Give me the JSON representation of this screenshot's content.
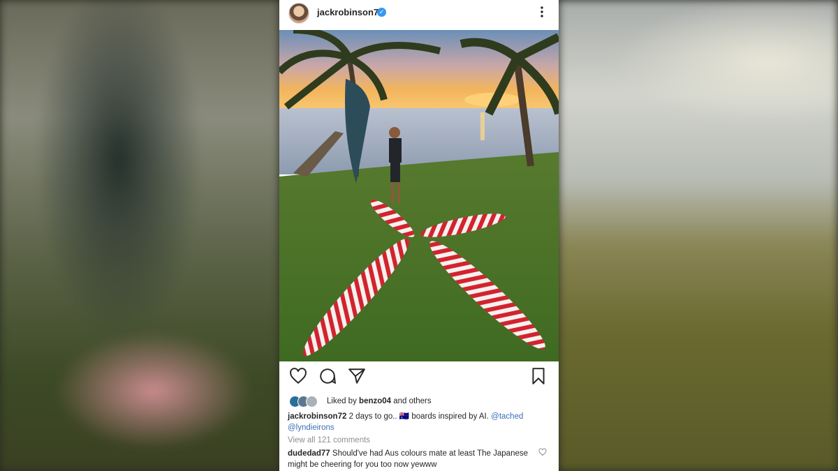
{
  "post": {
    "username": "jackrobinson72",
    "verified": true,
    "more_icon": "more-vertical-icon"
  },
  "actions": {
    "like_icon": "heart-icon",
    "comment_icon": "comment-icon",
    "share_icon": "send-icon",
    "save_icon": "bookmark-icon"
  },
  "likes": {
    "prefix": "Liked by",
    "user": "benzo04",
    "suffix": "and others"
  },
  "caption": {
    "username": "jackrobinson72",
    "text": "2 days to go..",
    "flag": "🇦🇺",
    "text2": "boards inspired by AI.",
    "mention1": "@tached",
    "mention2": "@lyndieirons"
  },
  "comments": {
    "view_all": "View all 121 comments",
    "first": {
      "username": "dudedad77",
      "text": "Should've had Aus colours mate at least The Japanese might be cheering for you too now yewww"
    }
  }
}
